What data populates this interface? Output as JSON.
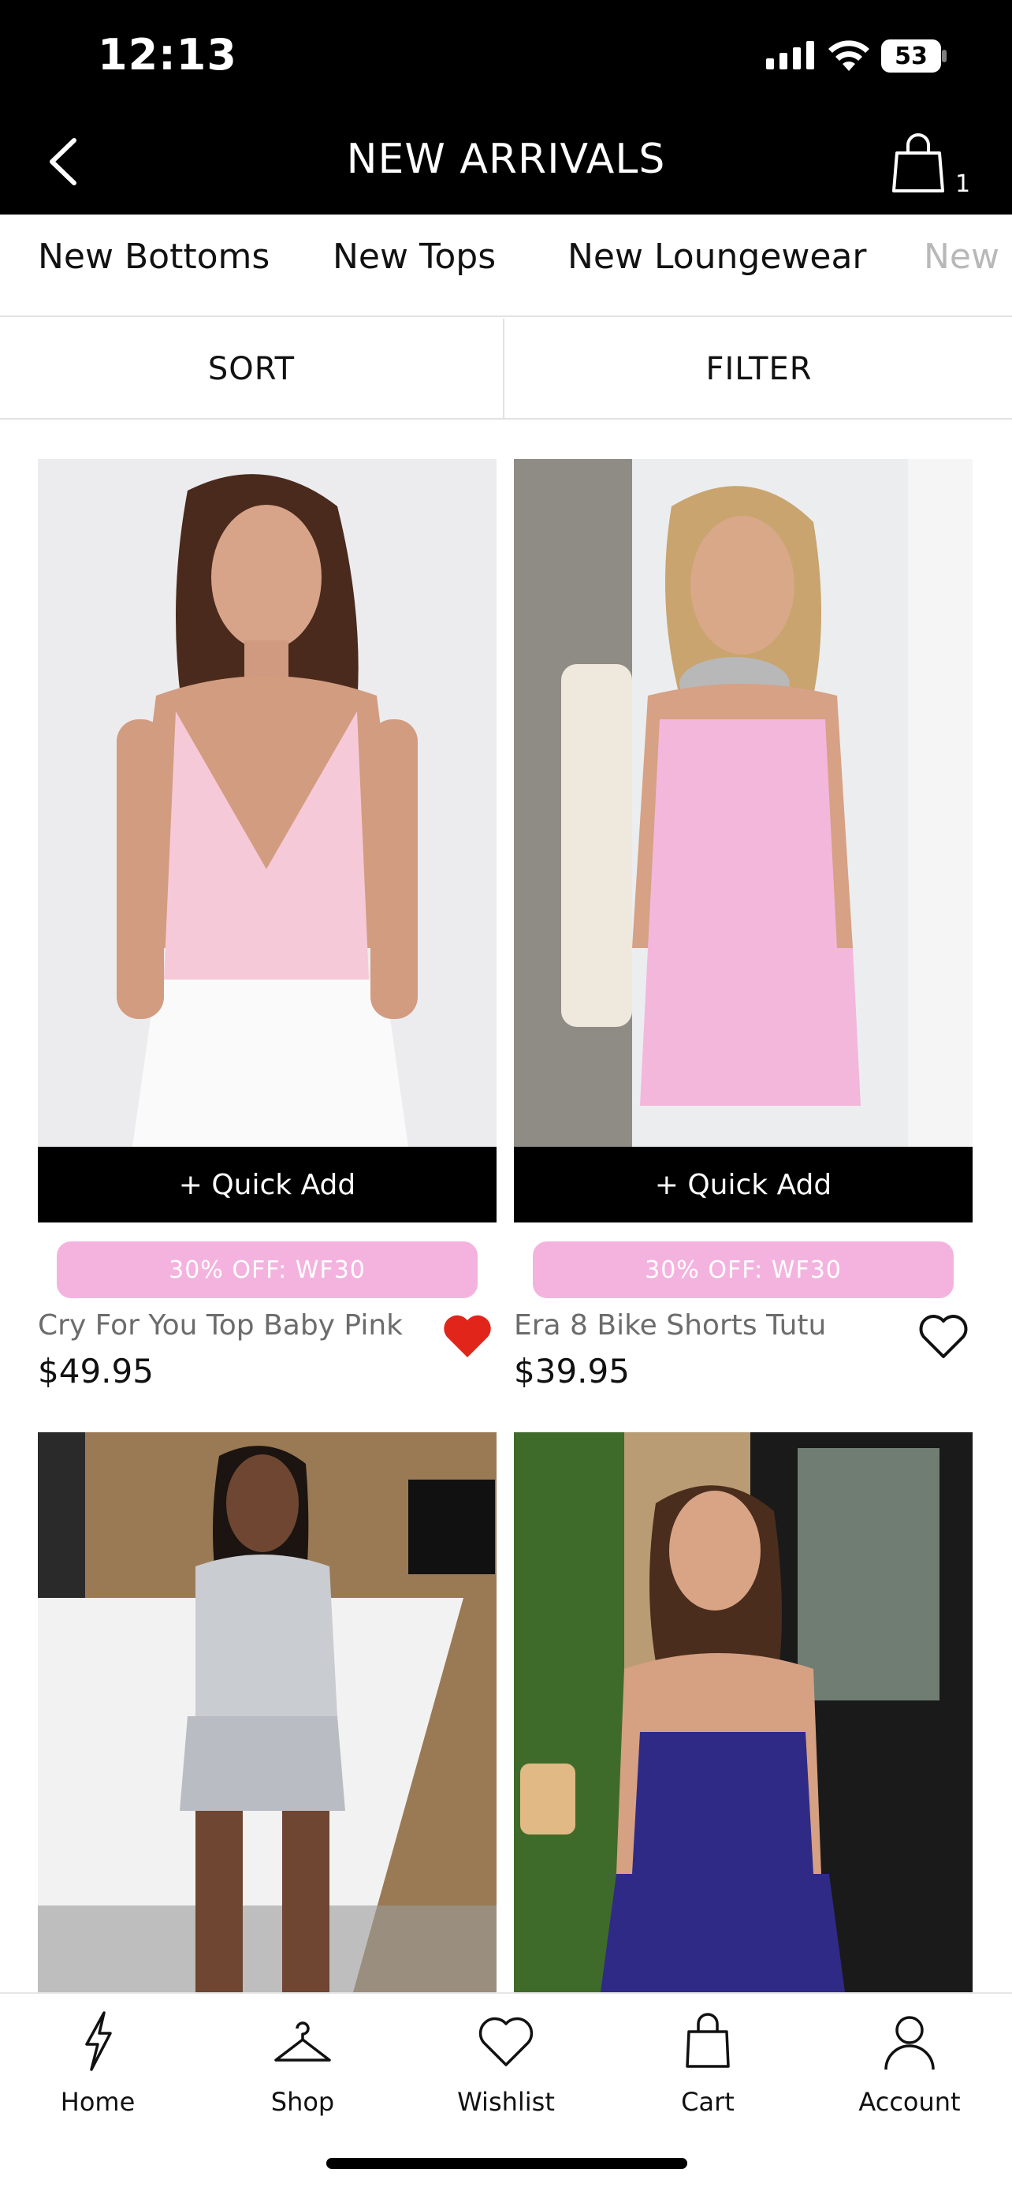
{
  "status": {
    "time": "12:13",
    "battery": "53"
  },
  "header": {
    "title": "NEW ARRIVALS",
    "cart_count": "1"
  },
  "tabs": [
    {
      "label": "New Bottoms"
    },
    {
      "label": "New Tops"
    },
    {
      "label": "New Loungewear"
    },
    {
      "label": "New"
    }
  ],
  "sortbar": {
    "sort": "SORT",
    "filter": "FILTER"
  },
  "products": [
    {
      "name": "Cry For You Top Baby Pink",
      "price": "$49.95",
      "quick_add": "+ Quick Add",
      "promo": "30% OFF: WF30",
      "wishlisted": true
    },
    {
      "name": "Era 8 Bike Shorts Tutu",
      "price": "$39.95",
      "quick_add": "+ Quick Add",
      "promo": "30% OFF: WF30",
      "wishlisted": false
    },
    {
      "name": "",
      "price": ""
    },
    {
      "name": "",
      "price": ""
    }
  ],
  "nav": [
    {
      "label": "Home",
      "icon": "lightning-icon"
    },
    {
      "label": "Shop",
      "icon": "hanger-icon"
    },
    {
      "label": "Wishlist",
      "icon": "heart-icon"
    },
    {
      "label": "Cart",
      "icon": "bag-icon"
    },
    {
      "label": "Account",
      "icon": "person-icon"
    }
  ],
  "colors": {
    "promo_pink": "#f4b3df",
    "heart_red": "#e1251b",
    "black": "#000000"
  }
}
